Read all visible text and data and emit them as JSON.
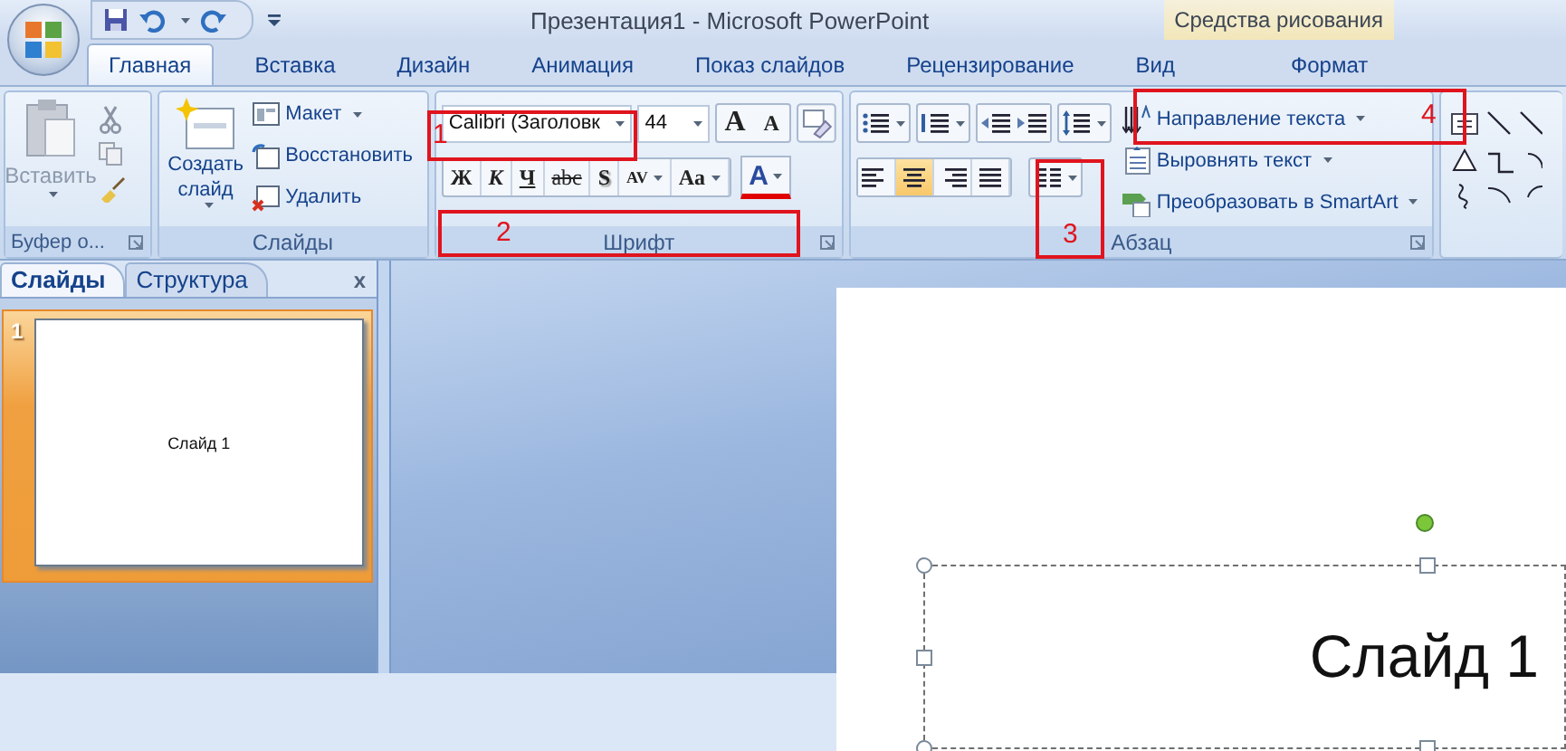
{
  "window": {
    "title": "Презентация1 - Microsoft PowerPoint"
  },
  "contextual_tab": {
    "label": "Средства рисования"
  },
  "tabs": [
    {
      "label": "Главная",
      "selected": true
    },
    {
      "label": "Вставка",
      "selected": false
    },
    {
      "label": "Дизайн",
      "selected": false
    },
    {
      "label": "Анимация",
      "selected": false
    },
    {
      "label": "Показ слайдов",
      "selected": false
    },
    {
      "label": "Рецензирование",
      "selected": false
    },
    {
      "label": "Вид",
      "selected": false
    },
    {
      "label": "Формат",
      "selected": false
    }
  ],
  "clipboard": {
    "title": "Буфер о...",
    "paste": {
      "label": "Вставить",
      "disabled": true
    }
  },
  "slides_group": {
    "title": "Слайды",
    "new_slide": "Создать слайд",
    "items": [
      "Макет",
      "Восстановить",
      "Удалить"
    ]
  },
  "font": {
    "title": "Шрифт",
    "font_name": "Calibri (Заголовк",
    "font_size": "44",
    "size_buttons": [
      "A",
      "A"
    ],
    "format_buttons": [
      "Ж",
      "К",
      "Ч",
      "abc",
      "S",
      "AV",
      "Aa"
    ],
    "color_button": "A"
  },
  "paragraph": {
    "title": "Абзац",
    "align": [
      {
        "selected": false
      },
      {
        "selected": true
      },
      {
        "selected": false
      },
      {
        "selected": false
      }
    ],
    "commands": [
      "Направление текста",
      "Выровнять текст",
      "Преобразовать в SmartArt"
    ]
  },
  "annotations": [
    {
      "label": "1"
    },
    {
      "label": "2"
    },
    {
      "label": "3"
    },
    {
      "label": "4"
    }
  ],
  "panel": {
    "tabs": [
      {
        "label": "Слайды",
        "selected": true
      },
      {
        "label": "Структура",
        "selected": false
      }
    ],
    "close": "x",
    "thumbnails": [
      {
        "number": "1",
        "title": "Слайд 1",
        "selected": true
      }
    ]
  },
  "slide": {
    "title": "Слайд 1"
  }
}
